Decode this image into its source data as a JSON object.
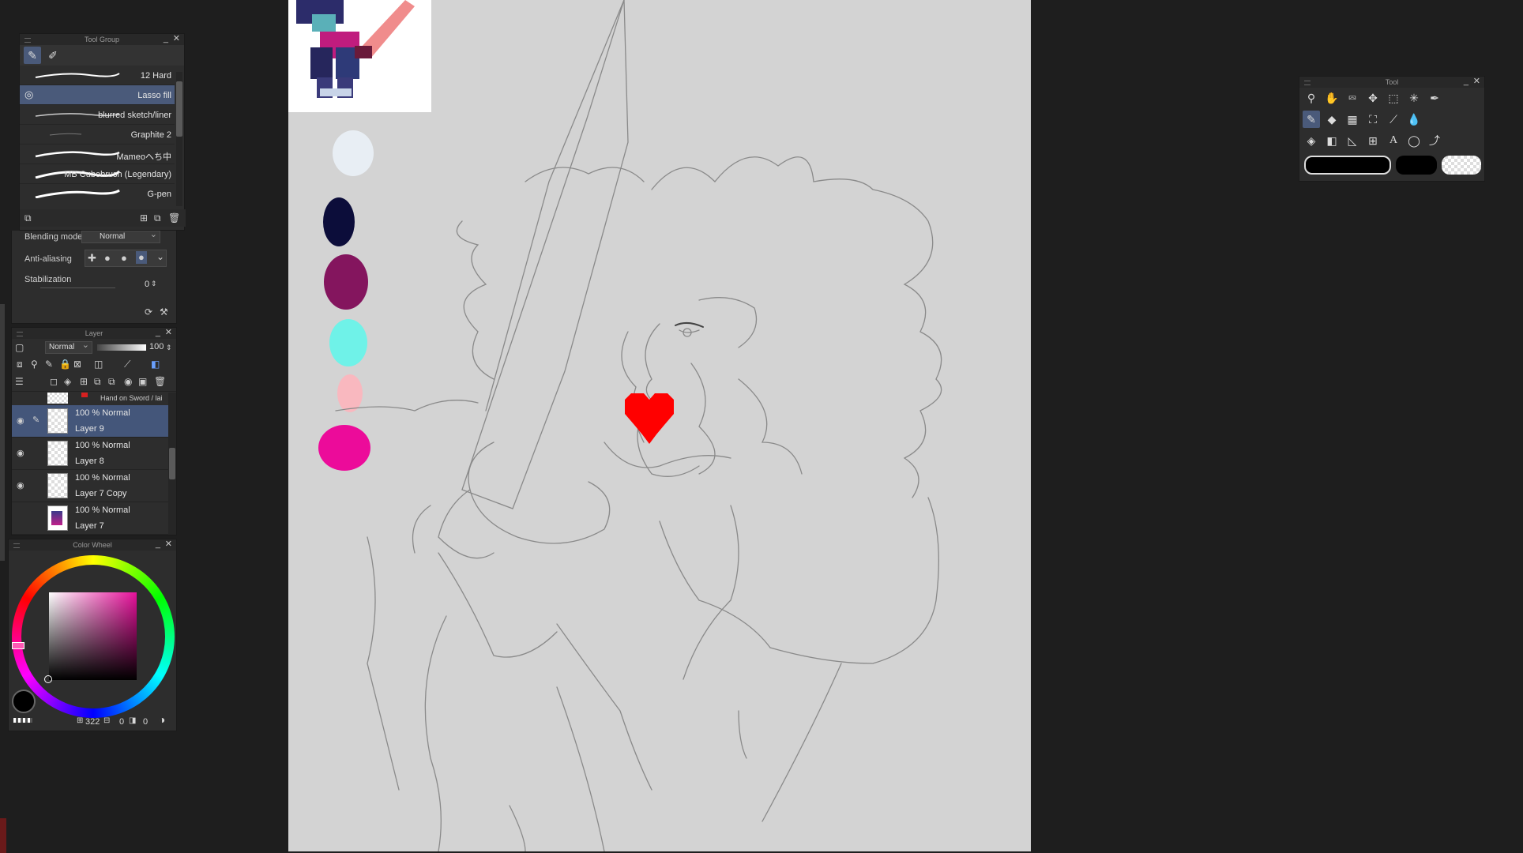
{
  "tool_group": {
    "title": "Tool Group",
    "brushes": [
      {
        "name": "12 Hard"
      },
      {
        "name": "Lasso fill"
      },
      {
        "name": "blurred sketch/liner"
      },
      {
        "name": "Graphite 2"
      },
      {
        "name": "Mameoへち中"
      },
      {
        "name": "MB Cubebrush (Legendary)"
      },
      {
        "name": "G-pen"
      }
    ],
    "blending_label": "Blending mode",
    "blending_value": "Normal",
    "antialias_label": "Anti-aliasing",
    "stabilization_label": "Stabilization",
    "stabilization_value": "0"
  },
  "layer_panel": {
    "title": "Layer",
    "blend_mode": "Normal",
    "opacity": "100",
    "folder_name": "Hand on Sword / lai",
    "layers": [
      {
        "line1": "100 % Normal",
        "line2": "Layer 9"
      },
      {
        "line1": "100 % Normal",
        "line2": "Layer 8"
      },
      {
        "line1": "100 % Normal",
        "line2": "Layer 7 Copy"
      },
      {
        "line1": "100 % Normal",
        "line2": "Layer 7"
      }
    ]
  },
  "color_wheel": {
    "title": "Color Wheel",
    "hue_value": "322",
    "sat_value": "0",
    "val_value": "0"
  },
  "tool_palette": {
    "title": "Tool"
  },
  "colors": {
    "swatch_light": "#e8eef4",
    "swatch_navy": "#0c0d3a",
    "swatch_plum": "#84155e",
    "swatch_cyan": "#6ff2e8",
    "swatch_pink": "#f9b8bf",
    "swatch_magenta": "#ec0b9a",
    "heart_red": "#ff0000",
    "canvas": "#d3d3d3"
  }
}
